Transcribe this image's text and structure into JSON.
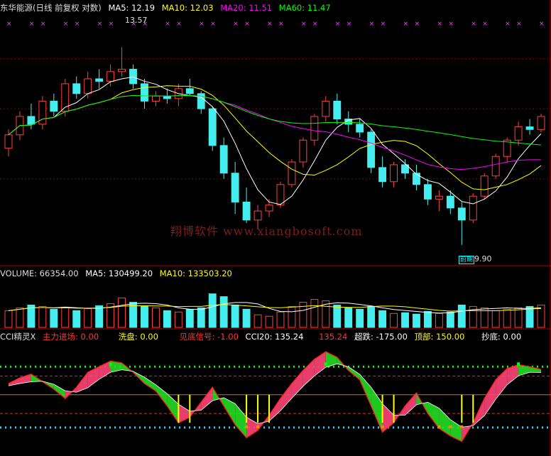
{
  "chart_data": [
    {
      "type": "candlestick",
      "title": "东华能源(日线 前复权 对数)",
      "indicators": [
        {
          "label": "MA5:",
          "value": "12.19",
          "color": "#ffffff"
        },
        {
          "label": "MA10:",
          "value": "12.03",
          "color": "#ffff00"
        },
        {
          "label": "MA20:",
          "value": "11.51",
          "color": "#ff00ff"
        },
        {
          "label": "MA60:",
          "value": "11.47",
          "color": "#00ff00"
        }
      ],
      "high_label": "13.57",
      "low_label": "9.90",
      "low_tag": "前期",
      "ylim": [
        9.6,
        14.3
      ],
      "ref_lines": [
        13.32,
        12.3,
        11.0
      ],
      "ohlc": [
        [
          11.55,
          11.9,
          11.4,
          11.8
        ],
        [
          11.8,
          12.25,
          11.7,
          12.15
        ],
        [
          12.15,
          12.4,
          11.9,
          12.0
        ],
        [
          12.0,
          12.55,
          11.9,
          12.45
        ],
        [
          12.45,
          12.6,
          12.15,
          12.25
        ],
        [
          12.25,
          12.9,
          12.15,
          12.8
        ],
        [
          12.8,
          12.95,
          12.5,
          12.6
        ],
        [
          12.6,
          13.05,
          12.5,
          12.9
        ],
        [
          12.9,
          13.1,
          12.7,
          12.85
        ],
        [
          12.85,
          13.2,
          12.75,
          13.05
        ],
        [
          13.05,
          13.57,
          12.95,
          13.1
        ],
        [
          13.1,
          13.2,
          12.7,
          12.8
        ],
        [
          12.8,
          12.9,
          12.3,
          12.45
        ],
        [
          12.45,
          12.65,
          12.35,
          12.55
        ],
        [
          12.55,
          12.7,
          12.4,
          12.5
        ],
        [
          12.5,
          12.8,
          12.35,
          12.7
        ],
        [
          12.7,
          12.9,
          12.55,
          12.6
        ],
        [
          12.6,
          12.65,
          12.2,
          12.3
        ],
        [
          12.3,
          12.35,
          11.5,
          11.6
        ],
        [
          11.6,
          11.75,
          11.0,
          11.1
        ],
        [
          11.1,
          11.3,
          10.4,
          10.6
        ],
        [
          10.6,
          10.85,
          10.25,
          10.3
        ],
        [
          10.3,
          10.55,
          10.15,
          10.45
        ],
        [
          10.45,
          10.65,
          10.35,
          10.55
        ],
        [
          10.55,
          10.95,
          10.5,
          10.9
        ],
        [
          10.9,
          11.35,
          10.85,
          11.3
        ],
        [
          11.3,
          11.75,
          11.2,
          11.7
        ],
        [
          11.7,
          12.2,
          11.6,
          12.15
        ],
        [
          12.15,
          12.55,
          12.05,
          12.45
        ],
        [
          12.45,
          12.6,
          12.0,
          12.1
        ],
        [
          12.1,
          12.25,
          11.85,
          12.0
        ],
        [
          12.0,
          12.1,
          11.75,
          11.85
        ],
        [
          11.85,
          11.9,
          11.1,
          11.2
        ],
        [
          11.2,
          11.4,
          10.85,
          10.95
        ],
        [
          10.95,
          11.3,
          10.85,
          11.25
        ],
        [
          11.25,
          11.35,
          11.0,
          11.1
        ],
        [
          11.1,
          11.25,
          10.8,
          10.9
        ],
        [
          10.9,
          11.0,
          10.55,
          10.65
        ],
        [
          10.65,
          10.8,
          10.45,
          10.7
        ],
        [
          10.7,
          10.8,
          10.4,
          10.5
        ],
        [
          10.5,
          10.6,
          9.9,
          10.3
        ],
        [
          10.3,
          10.75,
          10.25,
          10.7
        ],
        [
          10.7,
          11.1,
          10.65,
          11.05
        ],
        [
          11.05,
          11.45,
          11.0,
          11.4
        ],
        [
          11.4,
          11.75,
          11.3,
          11.7
        ],
        [
          11.7,
          12.05,
          11.6,
          11.95
        ],
        [
          11.95,
          12.1,
          11.8,
          11.9
        ],
        [
          11.9,
          12.2,
          11.85,
          12.15
        ]
      ]
    },
    {
      "type": "bar",
      "title": "VOLUME: 66354.00",
      "indicators": [
        {
          "label": "MA5:",
          "value": "130499.20",
          "color": "#ffffff"
        },
        {
          "label": "MA10:",
          "value": "133503.20",
          "color": "#ffff00"
        }
      ],
      "ylim": [
        0,
        350000
      ],
      "values": [
        120000,
        140000,
        160000,
        150000,
        130000,
        145000,
        120000,
        135000,
        155000,
        170000,
        210000,
        180000,
        150000,
        140000,
        120000,
        110000,
        130000,
        140000,
        240000,
        220000,
        160000,
        130000,
        90000,
        80000,
        110000,
        150000,
        180000,
        200000,
        190000,
        160000,
        140000,
        130000,
        150000,
        120000,
        100000,
        105000,
        95000,
        115000,
        100000,
        110000,
        160000,
        150000,
        140000,
        120000,
        130000,
        140000,
        150000,
        160000
      ]
    },
    {
      "type": "line",
      "title": "CCI精灵X",
      "indicators": [
        {
          "label": "主力进场:",
          "value": "0.00",
          "color": "#ff3333"
        },
        {
          "label": "洗盘:",
          "value": "0.00",
          "color": "#ffff00"
        },
        {
          "label": "见底信号:",
          "value": "-1.00",
          "color": "#ff3333"
        },
        {
          "label": "CCI20:",
          "value": "135.24",
          "color": "#ffffff"
        },
        {
          "label": "",
          "value": "135.24",
          "color": "#ff3333"
        },
        {
          "label": "超跌:",
          "value": "-175.00",
          "color": "#ffffff"
        },
        {
          "label": "顶部:",
          "value": "150.00",
          "color": "#ffff00"
        },
        {
          "label": "抄底:",
          "value": "0.00",
          "color": "#ffffff"
        }
      ],
      "ylim": [
        -320,
        280
      ],
      "ref_lines": [
        150,
        100,
        0,
        -100,
        -175
      ],
      "cci": [
        60,
        90,
        110,
        70,
        30,
        -20,
        40,
        120,
        150,
        180,
        170,
        120,
        60,
        20,
        -60,
        -150,
        -120,
        -40,
        40,
        -60,
        -160,
        -230,
        -190,
        -110,
        -20,
        60,
        130,
        190,
        230,
        200,
        130,
        80,
        -60,
        -200,
        -150,
        -60,
        10,
        -100,
        -180,
        -220,
        -250,
        -150,
        -20,
        80,
        140,
        160,
        150,
        135
      ]
    }
  ]
}
